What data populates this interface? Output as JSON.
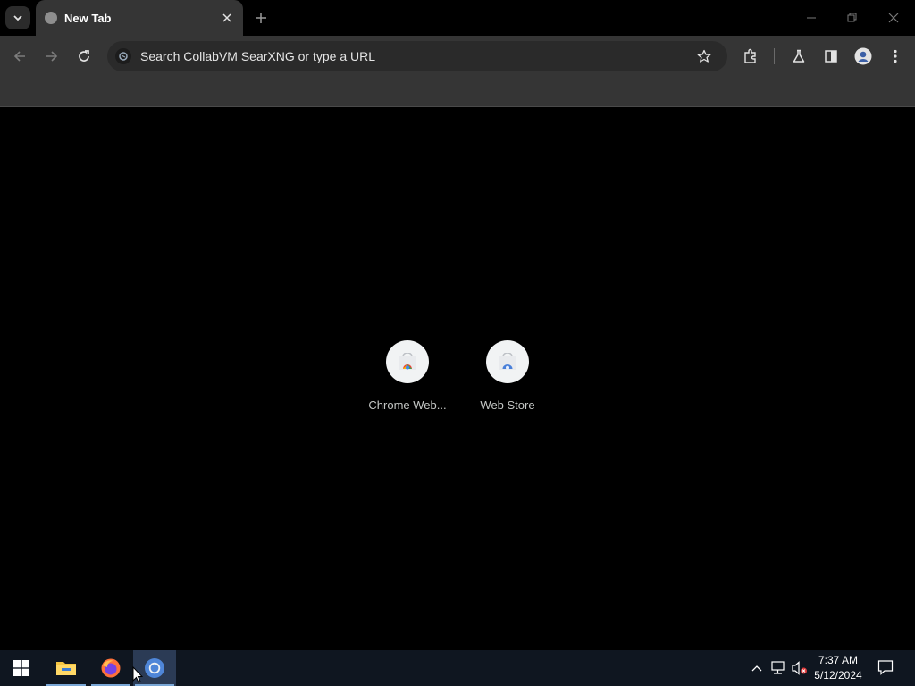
{
  "browser": {
    "tab": {
      "title": "New Tab"
    },
    "omnibox": {
      "placeholder": "Search CollabVM SearXNG or type a URL"
    }
  },
  "shortcuts": [
    {
      "label": "Chrome Web..."
    },
    {
      "label": "Web Store"
    }
  ],
  "taskbar": {
    "apps": [
      "start-icon",
      "file-explorer-icon",
      "firefox-icon",
      "chrome-icon"
    ],
    "clock": {
      "time": "7:37 AM",
      "date": "5/12/2024"
    }
  },
  "colors": {
    "page_bg": "#000000",
    "toolbar_bg": "#353535",
    "taskbar_bg": "#0f1620",
    "accent": "#7aa7d6"
  }
}
